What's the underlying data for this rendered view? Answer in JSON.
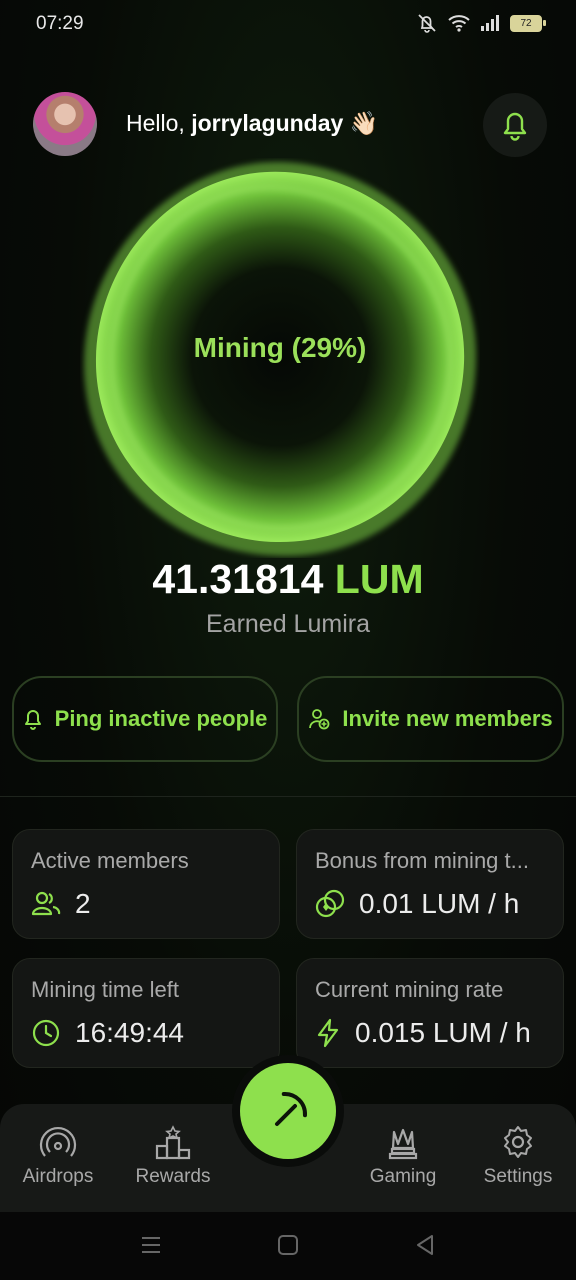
{
  "status_bar": {
    "time": "07:29",
    "battery": "72"
  },
  "header": {
    "greeting_prefix": "Hello, ",
    "username": "jorrylagunday",
    "wave": "👋🏻"
  },
  "mining": {
    "status_text": "Mining (29%)",
    "progress_percent": 29
  },
  "balance": {
    "amount": "41.31814",
    "unit": "LUM",
    "caption": "Earned Lumira"
  },
  "actions": {
    "ping": "Ping inactive people",
    "invite": "Invite new members"
  },
  "stats": {
    "active_members": {
      "label": "Active members",
      "value": "2"
    },
    "bonus": {
      "label": "Bonus from mining t...",
      "value": "0.01 LUM / h"
    },
    "time_left": {
      "label": "Mining time left",
      "value": "16:49:44"
    },
    "rate": {
      "label": "Current mining rate",
      "value": "0.015 LUM / h"
    }
  },
  "nav": {
    "airdrops": "Airdrops",
    "rewards": "Rewards",
    "gaming": "Gaming",
    "settings": "Settings"
  },
  "colors": {
    "accent": "#8ee04d",
    "background": "#070b06",
    "card": "#141614"
  }
}
